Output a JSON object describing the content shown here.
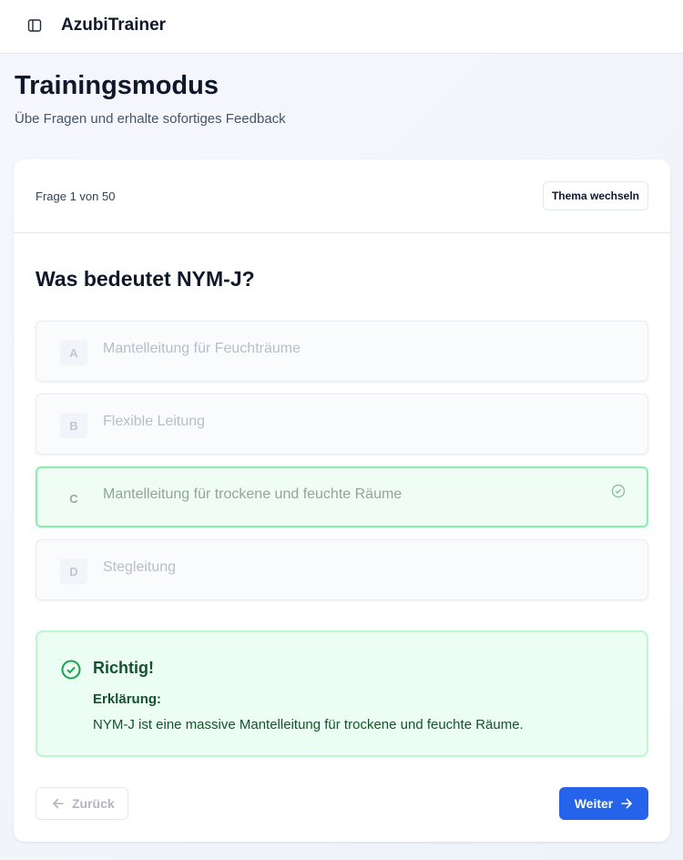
{
  "app": {
    "title": "AzubiTrainer"
  },
  "page": {
    "title": "Trainingsmodus",
    "subtitle": "Übe Fragen und erhalte sofortiges Feedback"
  },
  "quiz": {
    "progress": "Frage 1 von 50",
    "change_topic_label": "Thema wechseln",
    "question": "Was bedeutet NYM-J?",
    "options": [
      {
        "letter": "A",
        "label": "Mantelleitung für Feuchträume"
      },
      {
        "letter": "B",
        "label": "Flexible Leitung"
      },
      {
        "letter": "C",
        "label": "Mantelleitung für trockene und feuchte Räume",
        "correct": true
      },
      {
        "letter": "D",
        "label": "Stegleitung"
      }
    ]
  },
  "feedback": {
    "title": "Richtig!",
    "explanation_label": "Erklärung:",
    "explanation_text": "NYM-J ist eine massive Mantelleitung für trockene und feuchte Räume."
  },
  "nav": {
    "back_label": "Zurück",
    "next_label": "Weiter"
  },
  "colors": {
    "accent": "#2563eb",
    "success": "#16a34a",
    "success_bg": "#ecfdf3"
  },
  "icons": {
    "sidebar_toggle": "sidebar-icon",
    "correct_check": "check-circle-icon",
    "back": "arrow-left-icon",
    "next": "arrow-right-icon"
  }
}
